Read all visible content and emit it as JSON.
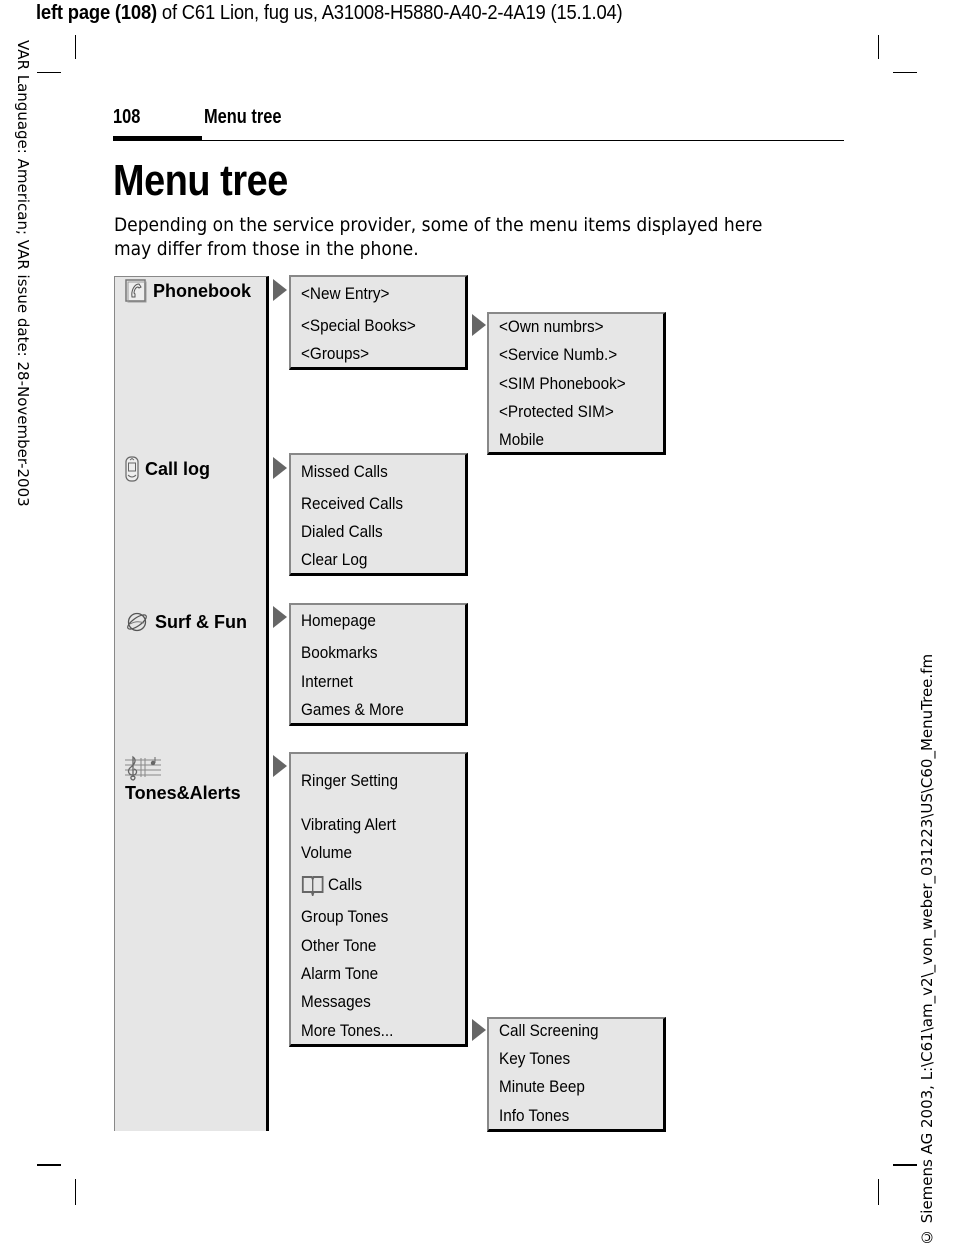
{
  "header": {
    "print_line_bold": "left page (108)",
    "print_line_rest": " of C61 Lion, fug us, A31008-H5880-A40-2-4A19 (15.1.04)",
    "page_number": "108",
    "running_title": "Menu tree"
  },
  "margins": {
    "left_text": "VAR Language: American; VAR issue date: 28-November-2003",
    "right_text": "© Siemens AG 2003, L:\\C61\\am_v2\\_von_weber_031223\\US\\C60_MenuTree.fm"
  },
  "title": "Menu tree",
  "intro": "Depending on the service provider, some of the menu items displayed here may differ from those in the phone.",
  "menu": {
    "phonebook": {
      "label": "Phonebook",
      "icon": "phonebook-icon",
      "items": [
        "<New Entry>",
        "<Special Books>",
        "<Groups>"
      ],
      "special_books": [
        "<Own numbrs>",
        "<Service Numb.>",
        "<SIM Phonebook>",
        "<Protected SIM>",
        "Mobile"
      ]
    },
    "call_log": {
      "label": "Call log",
      "icon": "mobile-phone-icon",
      "items": [
        "Missed Calls",
        "Received Calls",
        "Dialed Calls",
        "Clear Log"
      ]
    },
    "surf_fun": {
      "label": "Surf & Fun",
      "icon": "globe-icon",
      "items": [
        "Homepage",
        "Bookmarks",
        "Internet",
        "Games & More"
      ]
    },
    "tones_alerts": {
      "label": "Tones&Alerts",
      "icon": "music-staff-icon",
      "items": [
        "Ringer Setting",
        "Vibrating Alert",
        "Volume",
        "Calls",
        "Group Tones",
        "Other Tone",
        "Alarm Tone",
        "Messages",
        "More Tones..."
      ],
      "more_tones": [
        "Call Screening",
        "Key Tones",
        "Minute Beep",
        "Info Tones"
      ]
    }
  }
}
